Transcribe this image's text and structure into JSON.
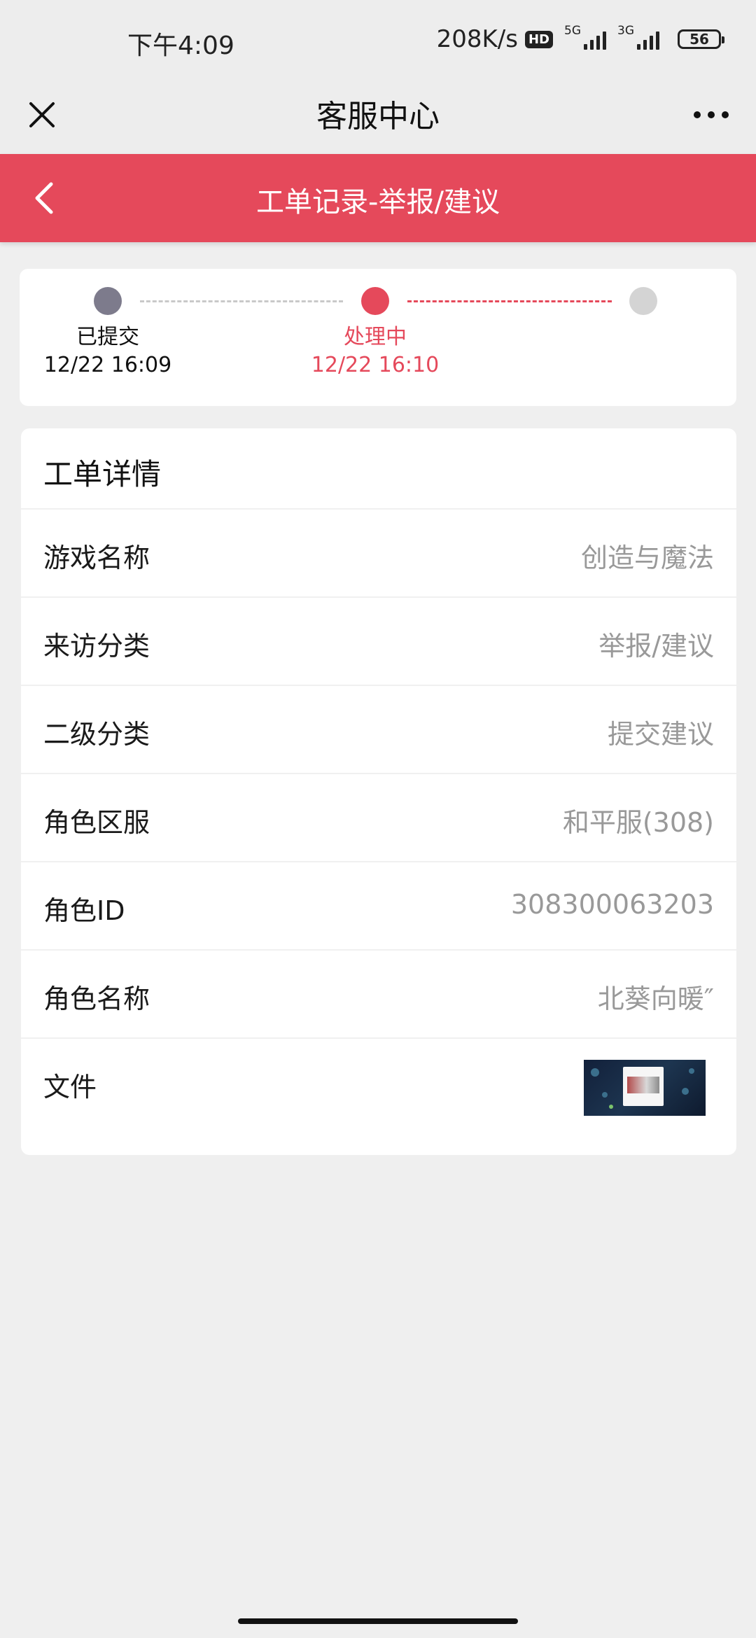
{
  "status_bar": {
    "time": "下午4:09",
    "net_speed": "208K/s",
    "hd_badge": "HD",
    "network_1": "5G",
    "network_2": "3G",
    "battery": "56"
  },
  "title_bar": {
    "title": "客服中心",
    "close_icon": "close-icon",
    "more_icon": "more-icon"
  },
  "header": {
    "title": "工单记录-举报/建议",
    "back_icon": "chevron-left-icon",
    "color": "#e5495b"
  },
  "progress": {
    "steps": [
      {
        "label": "已提交",
        "time": "12/22 16:09",
        "color": "#7d7b8c"
      },
      {
        "label": "处理中",
        "time": "12/22 16:10",
        "color": "#e5495b"
      },
      {
        "label": "",
        "time": "",
        "color": "#d4d4d4"
      }
    ]
  },
  "detail": {
    "heading": "工单详情",
    "rows": [
      {
        "label": "游戏名称",
        "value": "创造与魔法"
      },
      {
        "label": "来访分类",
        "value": "举报/建议"
      },
      {
        "label": "二级分类",
        "value": "提交建议"
      },
      {
        "label": "角色区服",
        "value": "和平服(308)"
      },
      {
        "label": "角色ID",
        "value": "308300063203"
      },
      {
        "label": "角色名称",
        "value": "北葵向暖″"
      },
      {
        "label": "文件",
        "value": ""
      }
    ]
  }
}
